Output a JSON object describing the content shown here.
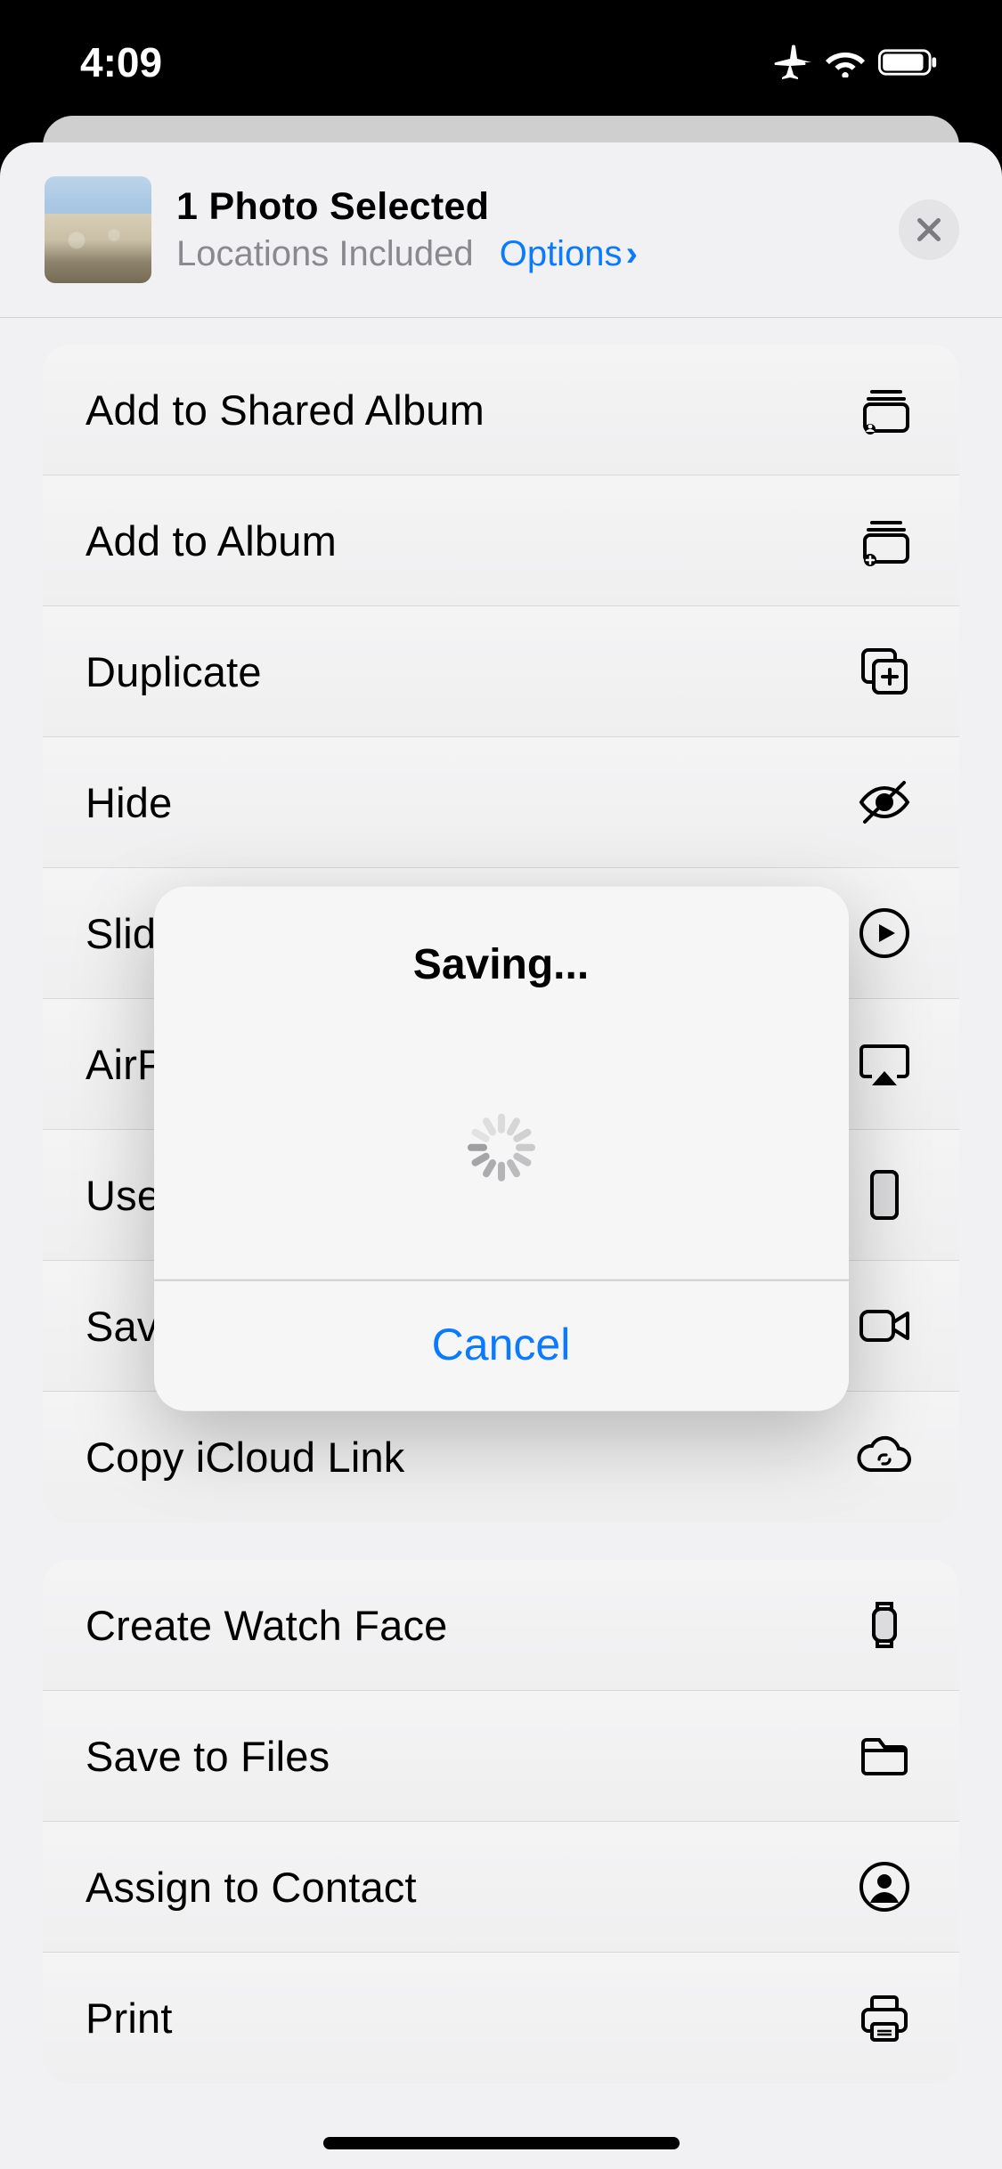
{
  "status": {
    "time": "4:09"
  },
  "header": {
    "title": "1 Photo Selected",
    "subtitle": "Locations Included",
    "options_label": "Options"
  },
  "groups": [
    {
      "rows": [
        {
          "label": "Add to Shared Album",
          "icon": "shared-album-icon"
        },
        {
          "label": "Add to Album",
          "icon": "add-album-icon"
        },
        {
          "label": "Duplicate",
          "icon": "duplicate-icon"
        },
        {
          "label": "Hide",
          "icon": "hide-icon"
        },
        {
          "label": "Slideshow",
          "icon": "play-circle-icon"
        },
        {
          "label": "AirPlay",
          "icon": "airplay-icon"
        },
        {
          "label": "Use as Wallpaper",
          "icon": "phone-icon"
        },
        {
          "label": "Save as Video",
          "icon": "video-icon"
        },
        {
          "label": "Copy iCloud Link",
          "icon": "cloud-link-icon"
        }
      ]
    },
    {
      "rows": [
        {
          "label": "Create Watch Face",
          "icon": "watch-icon"
        },
        {
          "label": "Save to Files",
          "icon": "folder-icon"
        },
        {
          "label": "Assign to Contact",
          "icon": "contact-circle-icon"
        },
        {
          "label": "Print",
          "icon": "printer-icon"
        }
      ]
    }
  ],
  "dialog": {
    "title": "Saving...",
    "cancel": "Cancel"
  }
}
